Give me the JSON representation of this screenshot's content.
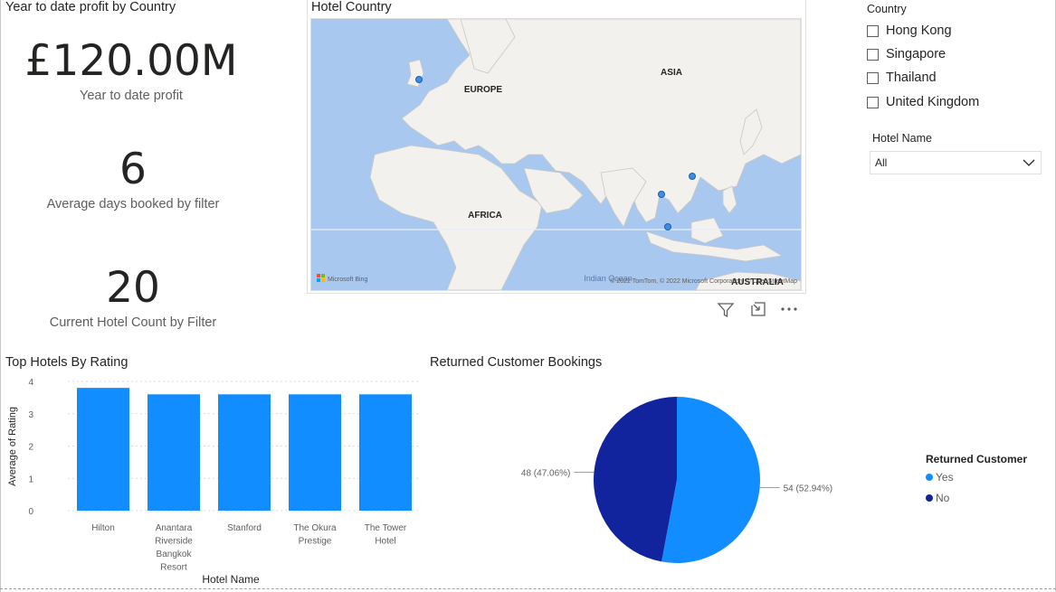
{
  "kpis": {
    "title": "Year to date profit by Country",
    "profit_value": "£120.00M",
    "profit_label": "Year to date profit",
    "days_value": "6",
    "days_label": "Average days booked by filter",
    "hotel_count_value": "20",
    "hotel_count_label": "Current Hotel Count by Filter"
  },
  "map": {
    "title": "Hotel Country",
    "region_labels": [
      "EUROPE",
      "ASIA",
      "AFRICA",
      "AUSTRALIA"
    ],
    "ocean_label": "Indian Ocean",
    "attribution": "© 2022 TomTom, © 2022 Microsoft Corporation, © OpenStreetMap",
    "bing_label": "Microsoft Bing",
    "colors": {
      "water": "#a9c8f0",
      "land": "#f2f1ee",
      "marker": "#3a8ee6"
    }
  },
  "visual_toolbar": {
    "filter_icon": "filter-icon",
    "focus_icon": "focus-mode-icon",
    "more_icon": "more-options-icon"
  },
  "slicers": {
    "country_label": "Country",
    "country_options": [
      "Hong Kong",
      "Singapore",
      "Thailand",
      "United Kingdom"
    ],
    "hotel_label": "Hotel Name",
    "hotel_selected": "All"
  },
  "bar_chart": {
    "title": "Top Hotels By Rating",
    "xlabel": "Hotel Name",
    "ylabel": "Average of Rating",
    "color": "#118dff",
    "tick_labels": [
      "0",
      "1",
      "2",
      "3",
      "4"
    ],
    "category_lines": [
      [
        "Hilton"
      ],
      [
        "Anantara",
        "Riverside",
        "Bangkok",
        "Resort"
      ],
      [
        "Stanford"
      ],
      [
        "The Okura",
        "Prestige"
      ],
      [
        "The Tower",
        "Hotel"
      ]
    ]
  },
  "pie_chart": {
    "title": "Returned Customer Bookings",
    "legend_title": "Returned Customer",
    "labels": [
      "54 (52.94%)",
      "48 (47.06%)"
    ],
    "legend": [
      "Yes",
      "No"
    ],
    "colors": [
      "#118dff",
      "#12239e"
    ]
  },
  "chart_data": [
    {
      "type": "bar",
      "title": "Top Hotels By Rating",
      "categories": [
        "Hilton",
        "Anantara Riverside Bangkok Resort",
        "Stanford",
        "The Okura Prestige",
        "The Tower Hotel"
      ],
      "values": [
        3.8,
        3.6,
        3.6,
        3.6,
        3.6
      ],
      "xlabel": "Hotel Name",
      "ylabel": "Average of Rating",
      "ylim": [
        0,
        4
      ],
      "grid": true
    },
    {
      "type": "pie",
      "title": "Returned Customer Bookings",
      "categories": [
        "Yes",
        "No"
      ],
      "values": [
        54,
        48
      ],
      "percentages": [
        52.94,
        47.06
      ],
      "legend_title": "Returned Customer",
      "legend_position": "right"
    }
  ]
}
